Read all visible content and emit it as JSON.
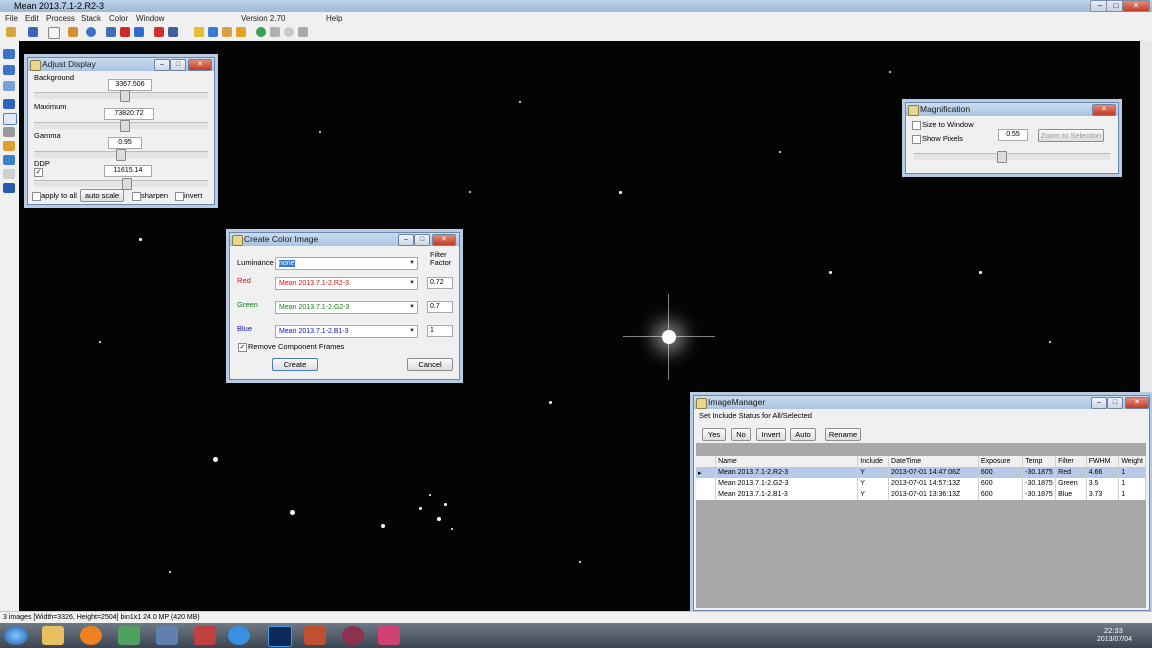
{
  "window": {
    "title": "Mean 2013.7.1-2.R2-3"
  },
  "menu": {
    "items": [
      "File",
      "Edit",
      "Process",
      "Stack",
      "Color",
      "Window"
    ],
    "version": "Version 2.70",
    "help": "Help"
  },
  "adjust_display": {
    "title": "Adjust Display",
    "background_label": "Background",
    "background_value": "3367.506",
    "maximum_label": "Maximum",
    "maximum_value": "73820.72",
    "gamma_label": "Gamma",
    "gamma_value": "0.95",
    "ddp_label": "DDP",
    "ddp_value": "11615.14",
    "ddp_checked": "✓",
    "apply_to_all": "apply to all",
    "auto_scale": "auto scale",
    "sharpen": "sharpen",
    "invert": "invert"
  },
  "magnification": {
    "title": "Magnification",
    "size_to_window": "Size to Window",
    "show_pixels": "Show Pixels",
    "value": "0.55",
    "zoom_to_selection": "Zoom to Selection",
    "slider_level": 0.44
  },
  "create_color": {
    "title": "Create Color Image",
    "luminance_label": "Luminance",
    "luminance_value": "none",
    "filter_factor_label": "Filter\nFactor",
    "red_label": "Red",
    "red_value": "Mean 2013.7.1-2.R2-3",
    "red_factor": "0.72",
    "green_label": "Green",
    "green_value": "Mean 2013.7.1-2.G2-3",
    "green_factor": "0.7",
    "blue_label": "Blue",
    "blue_value": "Mean 2013.7.1-2.B1-3",
    "blue_factor": "1",
    "remove_frames": "Remove Component Frames",
    "remove_checked": "✓",
    "create": "Create",
    "cancel": "Cancel",
    "colors": {
      "red": "#d01010",
      "green": "#108010",
      "blue": "#1010c0"
    }
  },
  "image_manager": {
    "title": "ImageManager",
    "set_include": "Set Include Status for All/Selected",
    "buttons": [
      "Yes",
      "No",
      "Invert",
      "Auto",
      "Rename"
    ],
    "columns": [
      "Name",
      "Include",
      "DateTime",
      "Exposure",
      "Temp",
      "Filter",
      "FWHM",
      "Weight"
    ],
    "rows": [
      [
        "Mean 2013.7.1-2.R2-3",
        "Y",
        "2013-07-01 14:47:06Z",
        "600",
        "-30.1875",
        "Red",
        "4.66",
        "1"
      ],
      [
        "Mean 2013.7.1-2.G2-3",
        "Y",
        "2013-07-01 14:57:13Z",
        "600",
        "-30.1875",
        "Green",
        "3.5",
        "1"
      ],
      [
        "Mean 2013.7.1-2.B1-3",
        "Y",
        "2013-07-01 13:36:13Z",
        "600",
        "-30.1875",
        "Blue",
        "3.73",
        "1"
      ]
    ]
  },
  "status": {
    "text": "3 images  [Width=3326, Height=2504] bin1x1  24.0 MP (420 MB)"
  },
  "taskbar": {
    "time": "22:33",
    "date": "2013/07/04"
  }
}
